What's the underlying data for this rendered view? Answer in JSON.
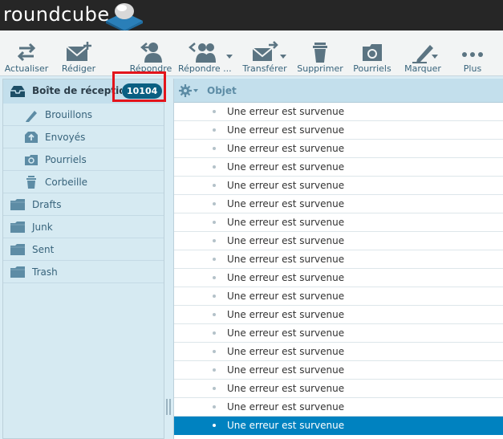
{
  "app": {
    "logo_text": "roundcube"
  },
  "toolbar": {
    "refresh": "Actualiser",
    "compose": "Rédiger",
    "reply": "Répondre",
    "reply_all": "Répondre ...",
    "forward": "Transférer",
    "delete": "Supprimer",
    "junk": "Pourriels",
    "mark": "Marquer",
    "more": "Plus"
  },
  "folders": {
    "inbox": {
      "label": "Boîte de réception",
      "unread": "10104"
    },
    "items": [
      {
        "label": "Brouillons",
        "icon": "pencil-icon"
      },
      {
        "label": "Envoyés",
        "icon": "sent-icon"
      },
      {
        "label": "Pourriels",
        "icon": "junk-folder-icon"
      },
      {
        "label": "Corbeille",
        "icon": "trash-icon"
      },
      {
        "label": "Drafts",
        "icon": "folder-icon"
      },
      {
        "label": "Junk",
        "icon": "folder-icon"
      },
      {
        "label": "Sent",
        "icon": "folder-icon"
      },
      {
        "label": "Trash",
        "icon": "folder-icon"
      }
    ]
  },
  "message_list": {
    "subject_header": "Objet",
    "messages": [
      "Une erreur est survenue",
      "Une erreur est survenue",
      "Une erreur est survenue",
      "Une erreur est survenue",
      "Une erreur est survenue",
      "Une erreur est survenue",
      "Une erreur est survenue",
      "Une erreur est survenue",
      "Une erreur est survenue",
      "Une erreur est survenue",
      "Une erreur est survenue",
      "Une erreur est survenue",
      "Une erreur est survenue",
      "Une erreur est survenue",
      "Une erreur est survenue",
      "Une erreur est survenue",
      "Une erreur est survenue",
      "Une erreur est survenue"
    ],
    "selected_index": 17
  },
  "colors": {
    "accent": "#0082c0",
    "badge": "#0a5f82",
    "highlight_box": "#e3141b",
    "topbar": "#262626"
  }
}
